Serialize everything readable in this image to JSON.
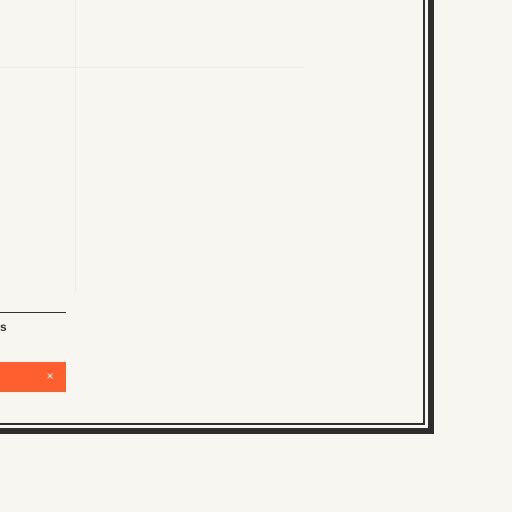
{
  "sidebar": {
    "label_tail": "s"
  },
  "alert": {
    "close_glyph": "×",
    "color": "#ff5f2e"
  },
  "frame": {
    "border_color": "#2e2e2e",
    "background": "#f8f6f0"
  }
}
